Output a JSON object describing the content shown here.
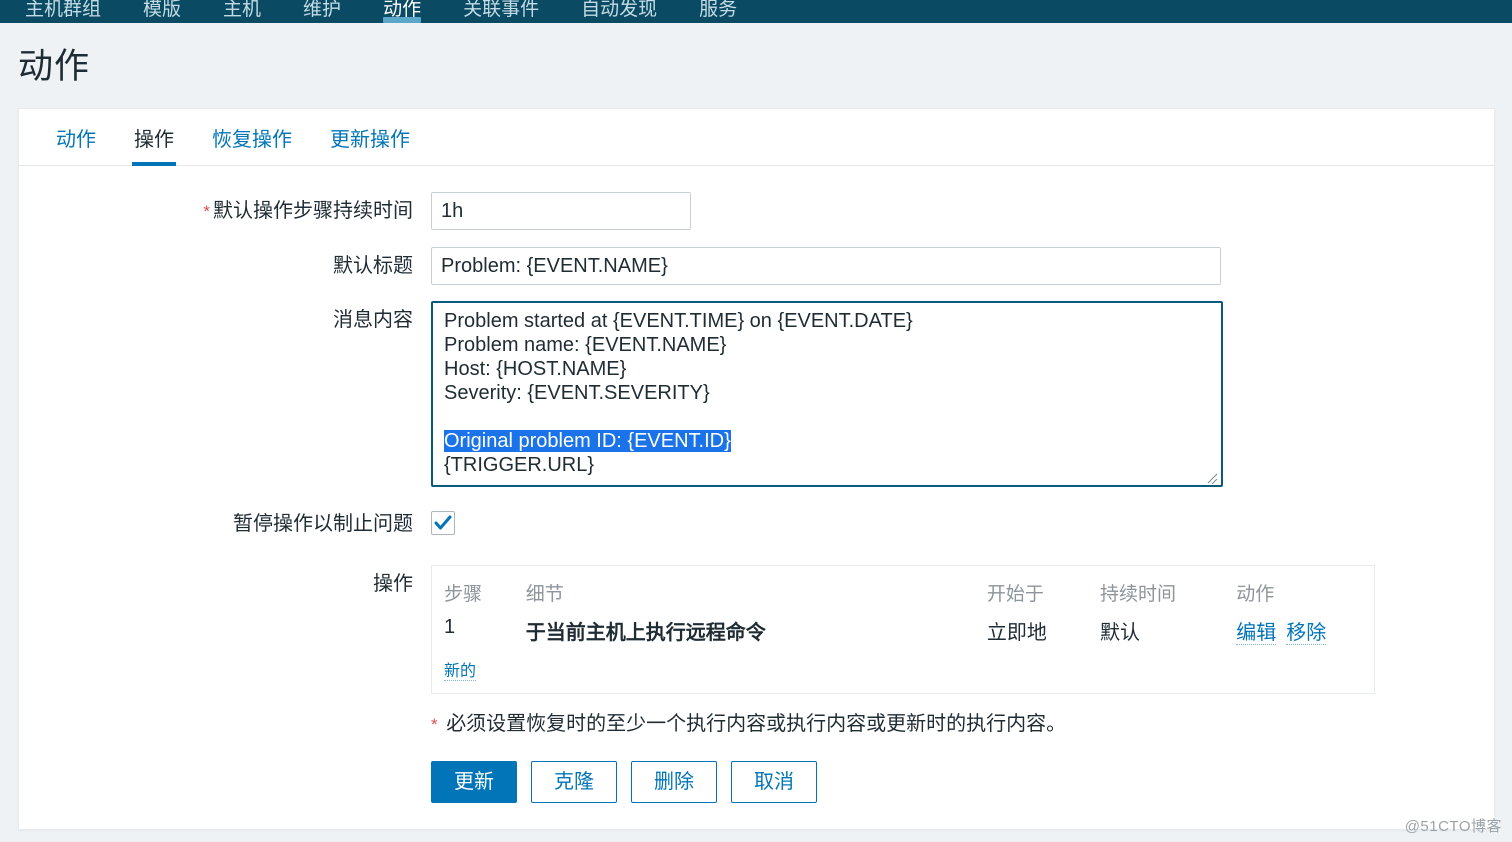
{
  "topnav": {
    "items": [
      {
        "label": "主机群组",
        "active": false
      },
      {
        "label": "模版",
        "active": false
      },
      {
        "label": "主机",
        "active": false
      },
      {
        "label": "维护",
        "active": false
      },
      {
        "label": "动作",
        "active": true
      },
      {
        "label": "关联事件",
        "active": false
      },
      {
        "label": "自动发现",
        "active": false
      },
      {
        "label": "服务",
        "active": false
      }
    ],
    "active_indicator_color": "#5ba7c9",
    "background_color": "#0a4b63"
  },
  "page": {
    "title": "动作",
    "background_color": "#eff2f5",
    "watermark": "@51CTO博客"
  },
  "tabs": [
    {
      "label": "动作",
      "active": false
    },
    {
      "label": "操作",
      "active": true
    },
    {
      "label": "恢复操作",
      "active": false
    },
    {
      "label": "更新操作",
      "active": false
    }
  ],
  "form": {
    "default_step_duration": {
      "label": "默认操作步骤持续时间",
      "required": true,
      "value": "1h"
    },
    "default_subject": {
      "label": "默认标题",
      "required": false,
      "value": "Problem: {EVENT.NAME}"
    },
    "default_message": {
      "label": "消息内容",
      "required": false,
      "lines_before": "Problem started at {EVENT.TIME} on {EVENT.DATE}\nProblem name: {EVENT.NAME}\nHost: {HOST.NAME}\nSeverity: {EVENT.SEVERITY}\n\n",
      "selected_text": "Original problem ID: {EVENT.ID}",
      "lines_after": "\n{TRIGGER.URL}",
      "selection_color": "#1a73e8",
      "focused": true
    },
    "pause_suppressed": {
      "label": "暂停操作以制止问题",
      "checked": true
    },
    "operations": {
      "label": "操作",
      "columns": [
        "步骤",
        "细节",
        "开始于",
        "持续时间",
        "动作"
      ],
      "rows": [
        {
          "step": "1",
          "detail": "于当前主机上执行远程命令",
          "start_in": "立即地",
          "duration": "默认",
          "actions": [
            "编辑",
            "移除"
          ]
        }
      ],
      "new_link": "新的"
    },
    "note": {
      "required_marker": "*",
      "text": "必须设置恢复时的至少一个执行内容或执行内容或更新时的执行内容。"
    },
    "buttons": [
      {
        "label": "更新",
        "style": "primary"
      },
      {
        "label": "克隆",
        "style": "ghost"
      },
      {
        "label": "删除",
        "style": "ghost"
      },
      {
        "label": "取消",
        "style": "ghost"
      }
    ]
  },
  "colors": {
    "accent": "#0275b8",
    "nav_bg": "#0a4b63",
    "required": "#d74f4f",
    "muted_text": "#8d959b"
  }
}
